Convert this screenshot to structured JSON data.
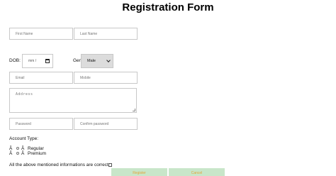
{
  "form": {
    "title": "Registration Form",
    "first_name_placeholder": "First Name",
    "last_name_placeholder": "Last Name",
    "dob_label": "DOB:",
    "dob_value": "mm / ",
    "gender_label": "Gender:",
    "gender_selected": "Male",
    "email_placeholder": "Email",
    "mobile_placeholder": "Mobile",
    "address_placeholder": "Address",
    "password_placeholder": "Password",
    "confirm_password_placeholder": "Confirm password",
    "account_type_label": "Account Type:",
    "account_options": [
      {
        "prefix": "Â",
        "mid": "Â",
        "label": "Regular"
      },
      {
        "prefix": "Â",
        "mid": "Â",
        "label": "Premium"
      }
    ],
    "agreement_text": "All the above mentioned informations are correct",
    "register_label": "Register",
    "cancel_label": "Cancel"
  },
  "colors": {
    "button_bg": "#c8e6c9",
    "button_text": "#e3a53a",
    "input_border": "#c8c8c8",
    "select_bg": "#dcdcdc"
  },
  "icons": {
    "dob": "calendar-icon",
    "gender": "chevron-down-icon"
  }
}
